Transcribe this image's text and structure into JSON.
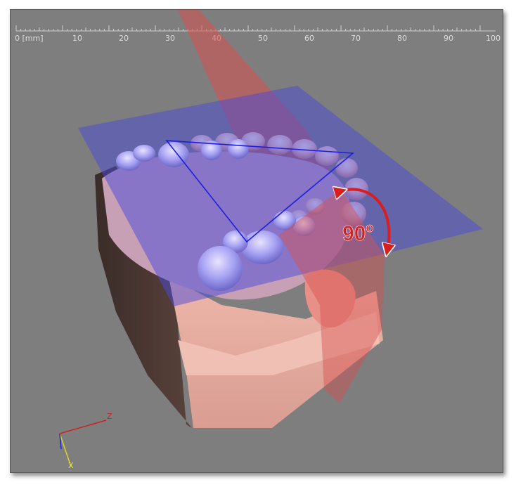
{
  "ruler": {
    "unit_label": "0 [mm]",
    "ticks": [
      "10",
      "20",
      "30",
      "40",
      "50",
      "60",
      "70",
      "80",
      "90",
      "100"
    ]
  },
  "annotation": {
    "angle_value": "90",
    "angle_degree": "o"
  },
  "axes": {
    "z_label": "Z",
    "x_label": "X"
  },
  "colors": {
    "background": "#7e7e7e",
    "occlusal_plane": "#4a4ad8",
    "sagittal_plane": "#d85050",
    "angle_arrow": "#d81e1e",
    "triangle": "#1e1ee0",
    "teeth_highlight": "#a7a2f2"
  }
}
